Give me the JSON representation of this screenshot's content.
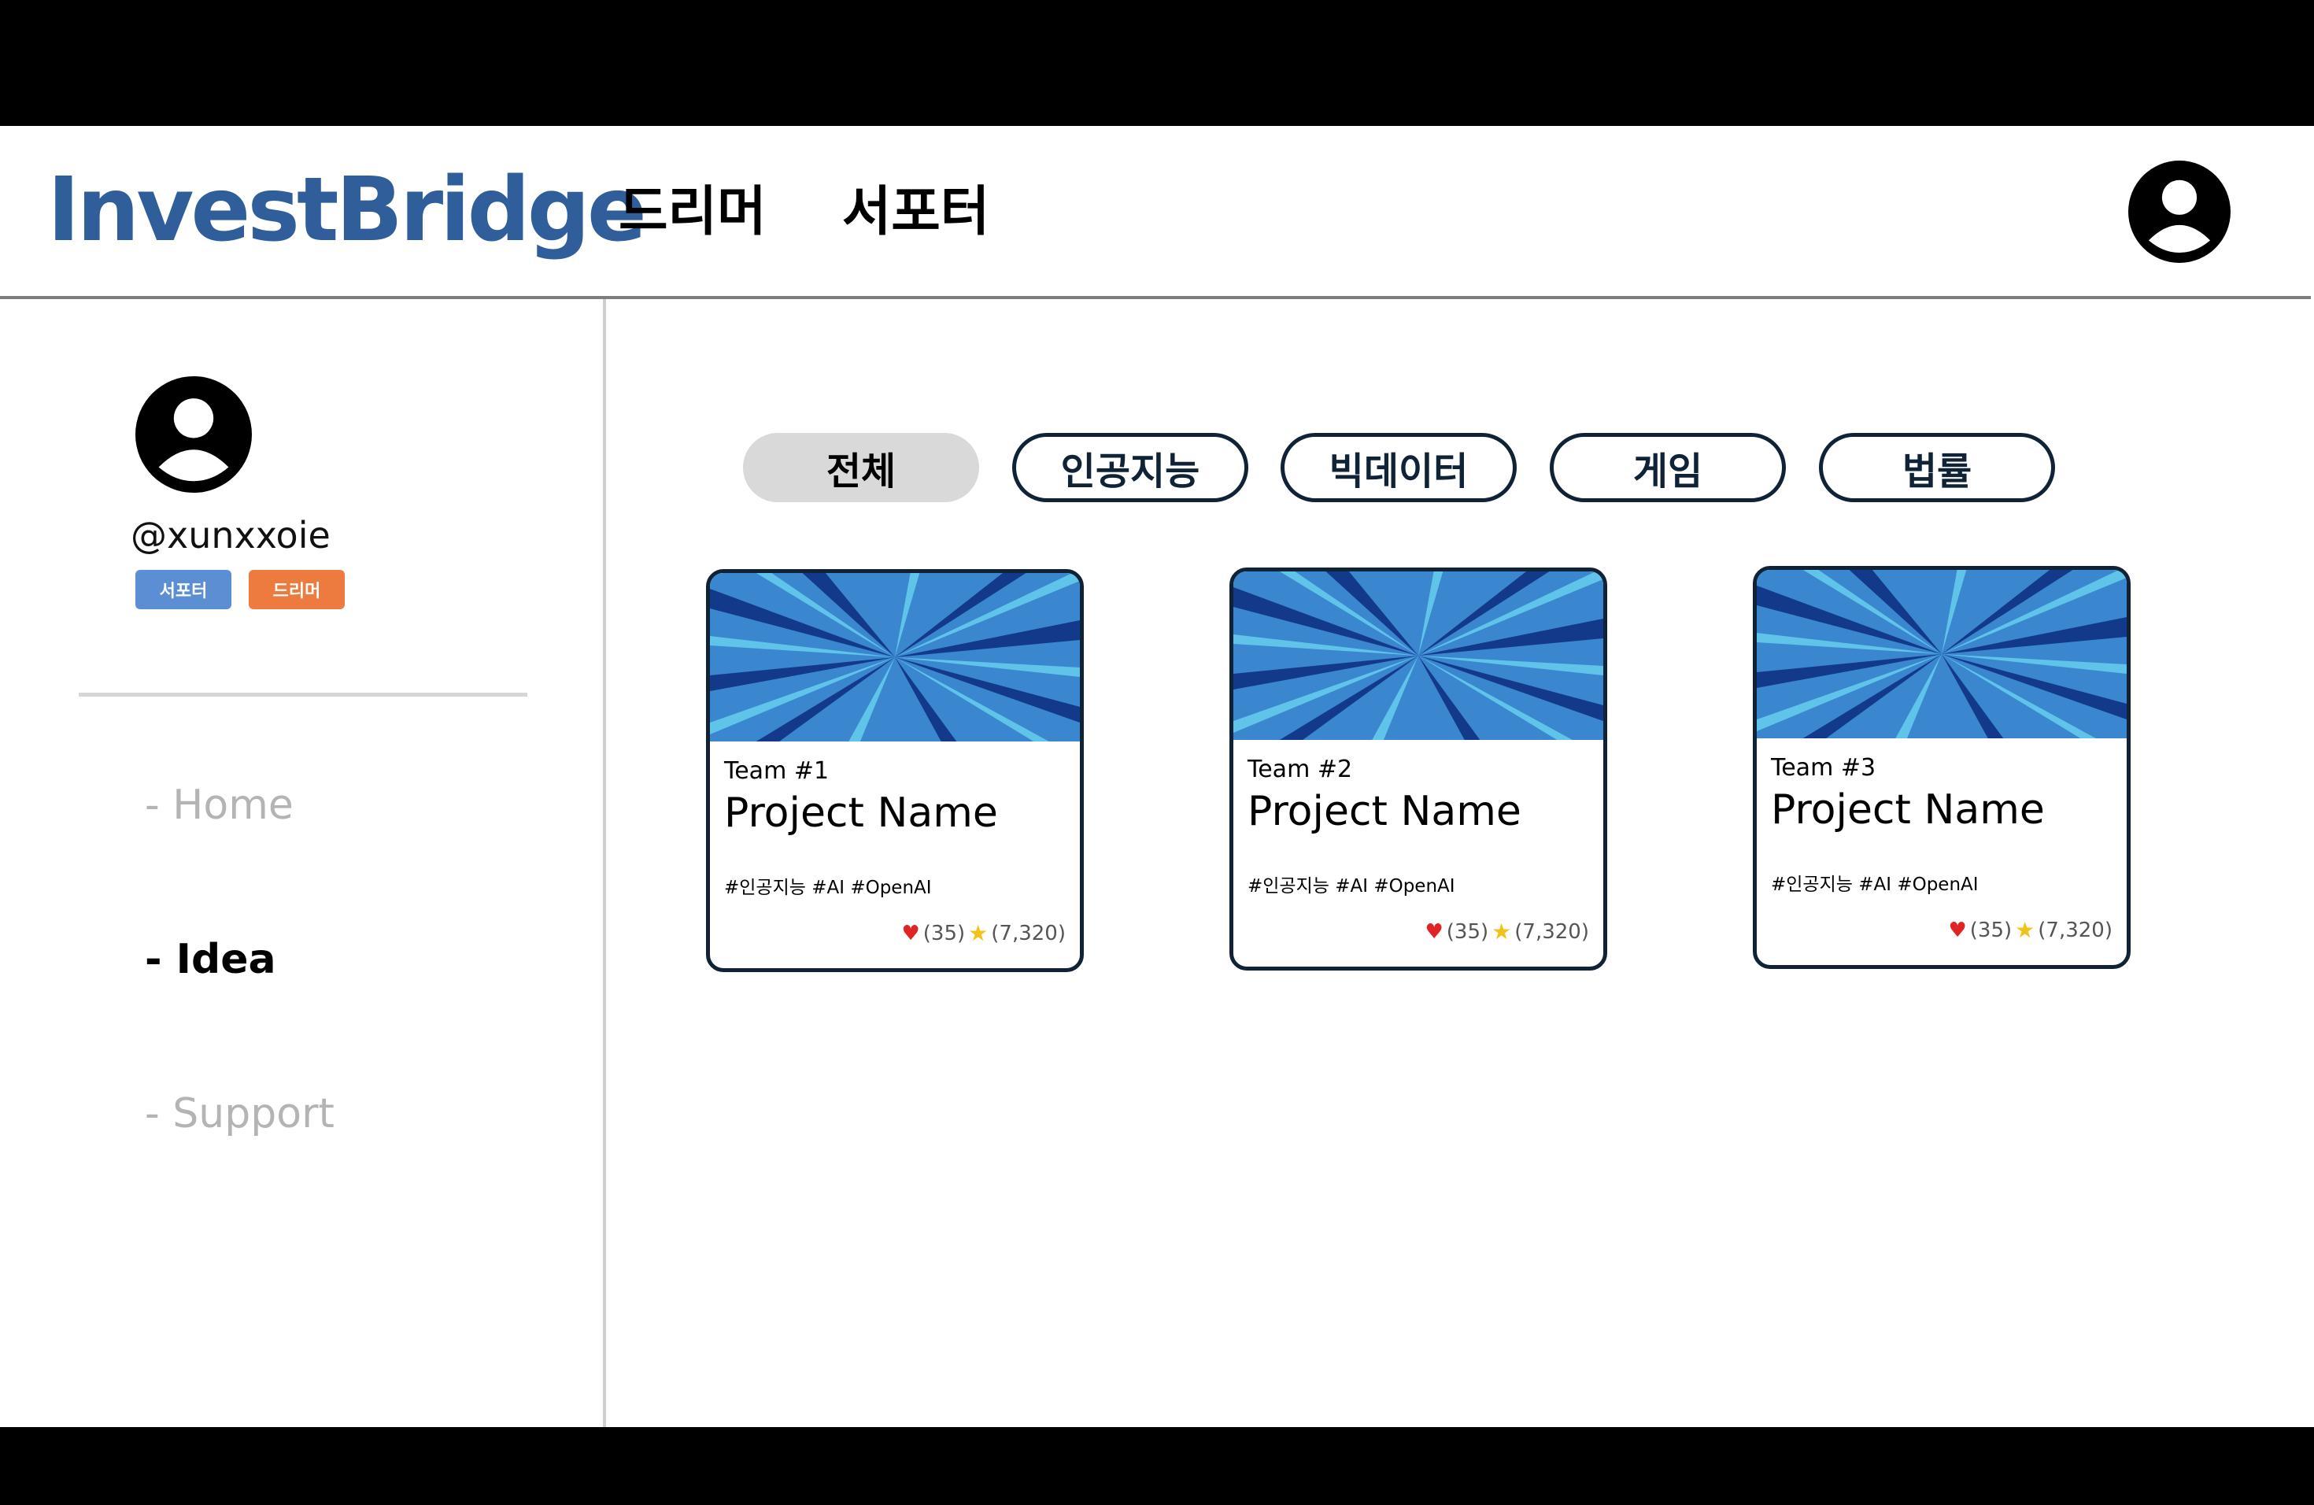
{
  "app": {
    "logo": "InvestBridge",
    "nav": [
      {
        "label": "드리머"
      },
      {
        "label": "서포터"
      }
    ]
  },
  "profile": {
    "username": "@xunxxoie",
    "badges": [
      {
        "label": "서포터",
        "color": "#5b8ed2"
      },
      {
        "label": "드리머",
        "color": "#ed7a3e"
      }
    ]
  },
  "sidebar": {
    "items": [
      {
        "label": "- Home",
        "active": false
      },
      {
        "label": "- Idea",
        "active": true
      },
      {
        "label": "- Support",
        "active": false
      }
    ]
  },
  "filters": [
    {
      "label": "전체",
      "active": true
    },
    {
      "label": "인공지능",
      "active": false
    },
    {
      "label": "빅데이터",
      "active": false
    },
    {
      "label": "게임",
      "active": false
    },
    {
      "label": "법률",
      "active": false
    }
  ],
  "cards": [
    {
      "team": "Team #1",
      "name": "Project Name",
      "tags": "#인공지능 #AI #OpenAI",
      "likes": "(35)",
      "stars": "(7,320)"
    },
    {
      "team": "Team #2",
      "name": "Project Name",
      "tags": "#인공지능 #AI #OpenAI",
      "likes": "(35)",
      "stars": "(7,320)"
    },
    {
      "team": "Team #3",
      "name": "Project Name",
      "tags": "#인공지능 #AI #OpenAI",
      "likes": "(35)",
      "stars": "(7,320)"
    }
  ],
  "icons": {
    "profile": "user-circle-icon",
    "like": "heart-icon",
    "favorite": "star-icon"
  },
  "colors": {
    "brand": "#2f5e9b",
    "border": "#0f2236",
    "banner": "#3a86cf"
  }
}
